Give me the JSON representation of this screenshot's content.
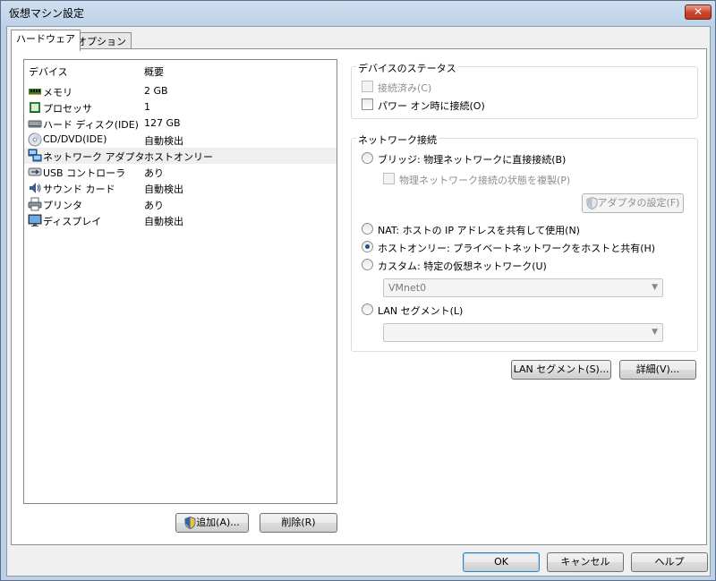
{
  "window": {
    "title": "仮想マシン設定",
    "close_label": "✕"
  },
  "tabs": [
    {
      "label": "ハードウェア",
      "active": true
    },
    {
      "label": "オプション",
      "active": false
    }
  ],
  "device_list": {
    "headers": {
      "device": "デバイス",
      "summary": "概要"
    },
    "rows": [
      {
        "name": "メモリ",
        "summary": "2 GB",
        "icon": "memory-icon"
      },
      {
        "name": "プロセッサ",
        "summary": "1",
        "icon": "processor-icon"
      },
      {
        "name": "ハード ディスク(IDE)",
        "summary": "127 GB",
        "icon": "hard-disk-icon"
      },
      {
        "name": "CD/DVD(IDE)",
        "summary": "自動検出",
        "icon": "cd-dvd-icon"
      },
      {
        "name": "ネットワーク アダプタ",
        "summary": "ホストオンリー",
        "icon": "network-adapter-icon",
        "selected": true
      },
      {
        "name": "USB コントローラ",
        "summary": "あり",
        "icon": "usb-icon"
      },
      {
        "name": "サウンド カード",
        "summary": "自動検出",
        "icon": "sound-icon"
      },
      {
        "name": "プリンタ",
        "summary": "あり",
        "icon": "printer-icon"
      },
      {
        "name": "ディスプレイ",
        "summary": "自動検出",
        "icon": "display-icon"
      }
    ]
  },
  "list_buttons": {
    "add": "追加(A)...",
    "remove": "削除(R)"
  },
  "device_status": {
    "title": "デバイスのステータス",
    "connected": {
      "label": "接続済み(C)",
      "checked": false,
      "disabled": true
    },
    "connect_on_power": {
      "label": "パワー オン時に接続(O)",
      "checked": false
    }
  },
  "network": {
    "title": "ネットワーク接続",
    "bridged": {
      "label": "ブリッジ: 物理ネットワークに直接接続(B)",
      "checked": false
    },
    "replicate": {
      "label": "物理ネットワーク接続の状態を複製(P)",
      "checked": false,
      "disabled": true
    },
    "adapter_settings": "アダプタの設定(F)",
    "nat": {
      "label": "NAT: ホストの IP アドレスを共有して使用(N)",
      "checked": false
    },
    "hostonly": {
      "label": "ホストオンリー: プライベートネットワークをホストと共有(H)",
      "checked": true
    },
    "custom": {
      "label": "カスタム: 特定の仮想ネットワーク(U)",
      "checked": false
    },
    "custom_value": "VMnet0",
    "lan_segment": {
      "label": "LAN セグメント(L)",
      "checked": false
    },
    "lan_segment_value": ""
  },
  "side_buttons": {
    "lan_segments": "LAN セグメント(S)...",
    "advanced": "詳細(V)..."
  },
  "footer": {
    "ok": "OK",
    "cancel": "キャンセル",
    "help": "ヘルプ"
  },
  "colors": {
    "window_frame": "#bcd0e6",
    "selection": "#efefef",
    "radio_dot": "#1f4e86"
  }
}
